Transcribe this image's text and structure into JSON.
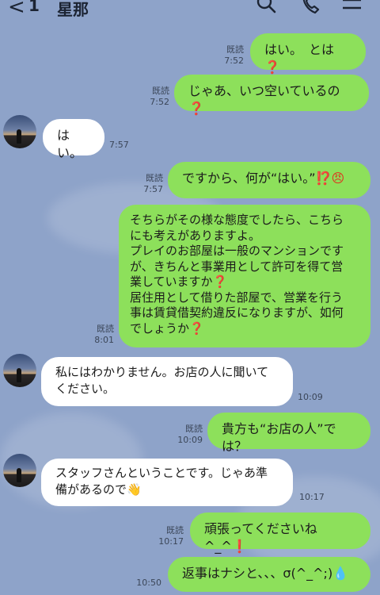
{
  "header": {
    "back_glyph": "<",
    "unread_count": "1",
    "contact_name": "星那"
  },
  "messages": [
    {
      "side": "sent",
      "text": "はい。　とは",
      "emoji": "❓",
      "read": "既読",
      "time": "7:52"
    },
    {
      "side": "sent",
      "text": "じゃあ、いつ空いているの",
      "emoji": "❓",
      "read": "既読",
      "time": "7:52"
    },
    {
      "side": "recv",
      "text": "はい。",
      "time": "7:57"
    },
    {
      "side": "sent",
      "text": "ですから、何が“はい。”",
      "emoji": "⁉️😠",
      "read": "既読",
      "time": "7:57"
    },
    {
      "side": "sent",
      "lines": [
        "そちらがその様な態度でしたら、こちら",
        "にも考えがありますよ。",
        "プレイのお部屋は一般のマンションです",
        "が、きちんと事業用として許可を得て営",
        "業していますか",
        "居住用として借りた部屋で、営業を行う",
        "事は賃貸借契約違反になりますが、如何",
        "でしょうか"
      ],
      "read": "既読",
      "time": "8:01"
    },
    {
      "side": "recv",
      "lines": [
        "私にはわかりません。お店の人に聞いて",
        "ください。"
      ],
      "time": "10:09"
    },
    {
      "side": "sent",
      "text": "貴方も“お店の人”では？",
      "read": "既読",
      "time": "10:09"
    },
    {
      "side": "recv",
      "lines": [
        "スタッフさんということです。じゃあ準",
        "備があるので"
      ],
      "emoji": "👋",
      "time": "10:17"
    },
    {
      "side": "sent",
      "text": "頑張ってくださいね^_^",
      "emoji": "❗",
      "read": "既読",
      "time": "10:17"
    },
    {
      "side": "sent",
      "text": "返事はナシと、、、σ(^_^;)",
      "emoji": "💧",
      "time": "10:50"
    }
  ],
  "icons": [
    "search-icon",
    "phone-icon",
    "menu-icon"
  ],
  "colors": {
    "background": "#8ea3c9",
    "sent_bubble": "#8de05b",
    "recv_bubble": "#ffffff"
  }
}
